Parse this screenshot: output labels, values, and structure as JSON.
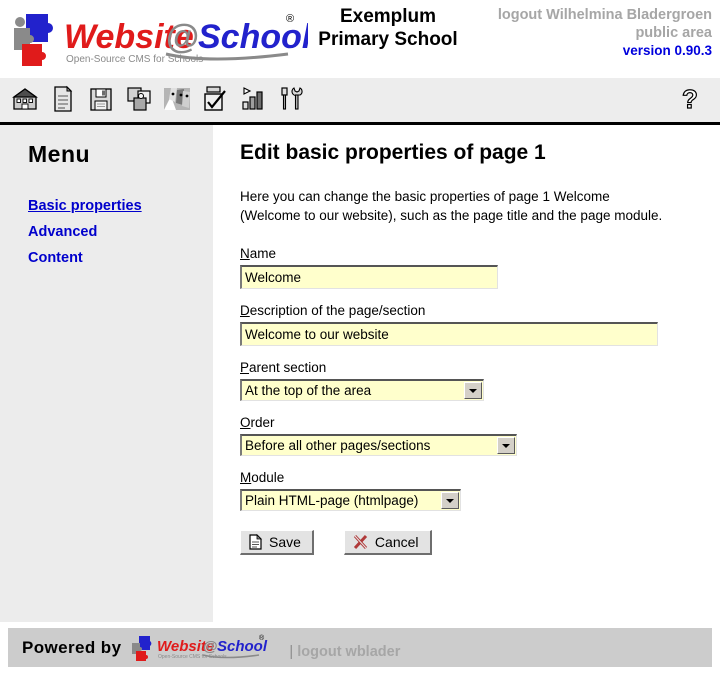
{
  "header": {
    "logo_alt": "Website@School",
    "logo_tagline": "Open-Source CMS for Schools",
    "school_name_line1": "Exemplum",
    "school_name_line2": "Primary School",
    "logout_user": "logout Wilhelmina Bladergroen",
    "area": "public area",
    "version": "version 0.90.3",
    "colors": {
      "version_blue": "#0000dd",
      "muted_gray": "#a6a6a6"
    }
  },
  "toolbar": {
    "icons": [
      {
        "name": "school-icon",
        "title": "School"
      },
      {
        "name": "page-icon",
        "title": "Page"
      },
      {
        "name": "save-disk-icon",
        "title": "Save"
      },
      {
        "name": "modules-puzzle-icon",
        "title": "Modules"
      },
      {
        "name": "areas-people-icon",
        "title": "Areas"
      },
      {
        "name": "pagemanager-checklist-icon",
        "title": "Pagemanager"
      },
      {
        "name": "statistics-chart-icon",
        "title": "Statistics"
      },
      {
        "name": "tools-icon",
        "title": "Tools"
      }
    ],
    "help_icon": "help-question-icon"
  },
  "sidebar": {
    "title": "Menu",
    "items": [
      {
        "label": "Basic properties",
        "active": true
      },
      {
        "label": "Advanced",
        "active": false
      },
      {
        "label": "Content",
        "active": false
      }
    ],
    "link_color": "#0000cc",
    "background": "#ececec"
  },
  "main": {
    "page_title": "Edit basic properties of page 1",
    "intro": "Here you can change the basic properties of page 1 Welcome (Welcome to our website), such as the page title and the page module.",
    "fields": {
      "name": {
        "label_accesskey": "N",
        "label_rest": "ame",
        "value": "Welcome"
      },
      "description": {
        "label_accesskey": "D",
        "label_rest": "escription of the page/section",
        "value": "Welcome to our website"
      },
      "parent_section": {
        "label_accesskey": "P",
        "label_rest": "arent section",
        "value": "At the top of the area"
      },
      "order": {
        "label_accesskey": "O",
        "label_rest": "rder",
        "value": "Before all other pages/sections"
      },
      "module": {
        "label_accesskey": "M",
        "label_rest": "odule",
        "value": "Plain HTML-page (htmlpage)"
      }
    },
    "buttons": {
      "save": {
        "label": "Save",
        "icon": "save-page-icon"
      },
      "cancel": {
        "label": "Cancel",
        "icon": "cancel-cross-icon"
      }
    },
    "input_background": "#ffffcc"
  },
  "footer": {
    "powered_by": "Powered by",
    "logo_alt": "Website@School",
    "separator": "|",
    "logout": "logout wblader",
    "background": "#cccccc"
  }
}
